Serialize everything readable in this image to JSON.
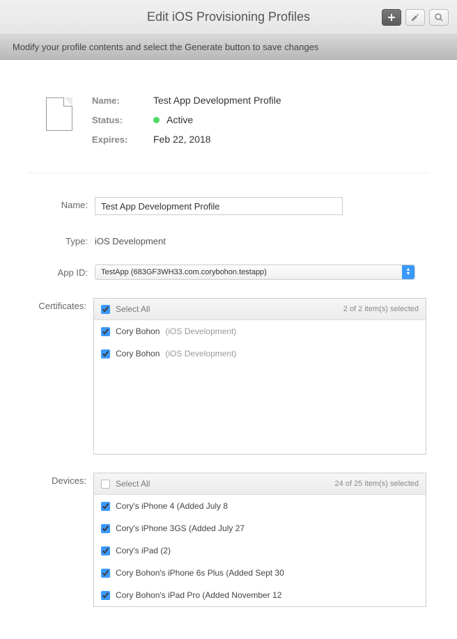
{
  "header": {
    "title": "Edit iOS Provisioning Profiles"
  },
  "subheader": {
    "text": "Modify your profile contents and select the Generate button to save changes"
  },
  "summary": {
    "name_label": "Name:",
    "name_value": "Test App Development Profile",
    "status_label": "Status:",
    "status_value": "Active",
    "expires_label": "Expires:",
    "expires_value": "Feb 22, 2018"
  },
  "form": {
    "name_label": "Name:",
    "name_value": "Test App Development Profile",
    "type_label": "Type:",
    "type_value": "iOS Development",
    "appid_label": "App ID:",
    "appid_value": "TestApp (683GF3WH33.com.corybohon.testapp)",
    "certificates_label": "Certificates:",
    "devices_label": "Devices:"
  },
  "certificates": {
    "select_all_label": "Select All",
    "count_text": "2 of 2 item(s) selected",
    "items": [
      {
        "name": "Cory Bohon",
        "detail": "(iOS Development)",
        "checked": true
      },
      {
        "name": "Cory Bohon",
        "detail": "(iOS Development)",
        "checked": true
      }
    ]
  },
  "devices": {
    "select_all_label": "Select All",
    "count_text": "24 of 25 item(s) selected",
    "items": [
      {
        "label": "Cory's iPhone 4 (Added July 8",
        "checked": true
      },
      {
        "label": "Cory's iPhone 3GS (Added July 27",
        "checked": true
      },
      {
        "label": "Cory's iPad (2)",
        "checked": true
      },
      {
        "label": "Cory Bohon's iPhone 6s Plus (Added Sept 30",
        "checked": true
      },
      {
        "label": "Cory Bohon's iPad Pro (Added November 12",
        "checked": true
      }
    ]
  }
}
